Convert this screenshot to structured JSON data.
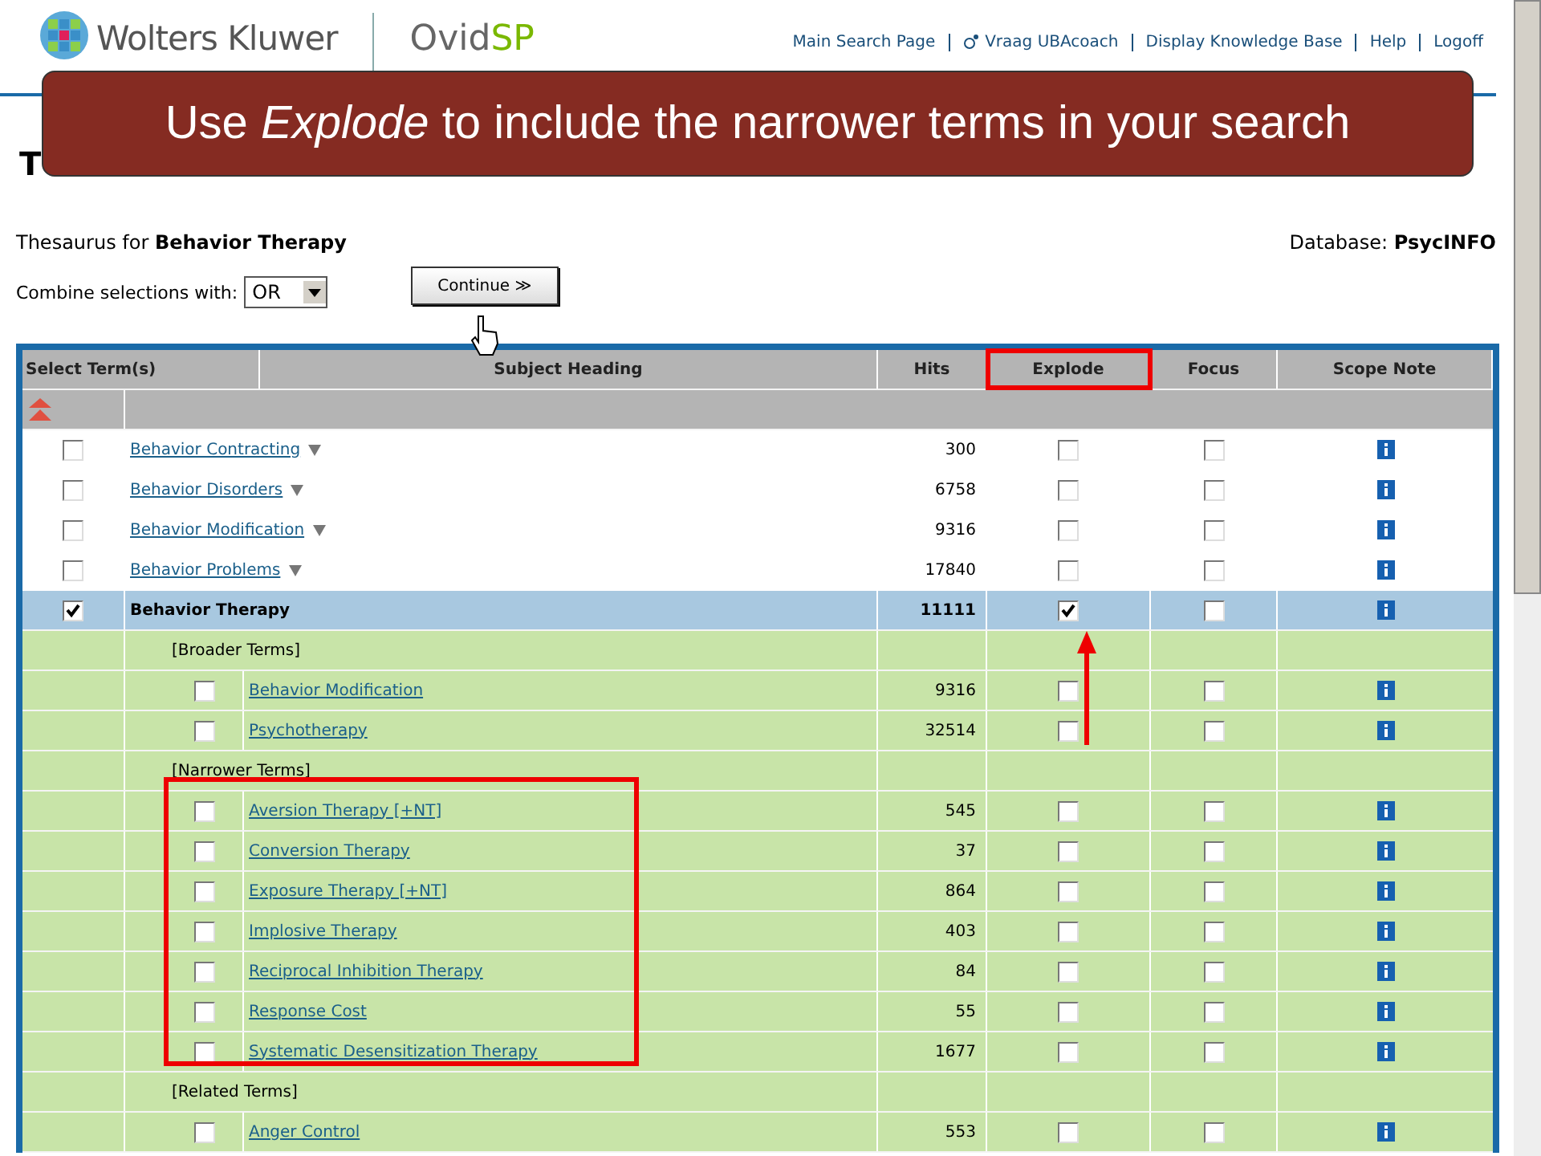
{
  "header": {
    "brand": "Wolters Kluwer",
    "product": "Ovid",
    "product_suffix": "SP",
    "nav": [
      {
        "label": "Main Search Page",
        "kind": "link"
      },
      {
        "label": "Vraag UBAcoach",
        "kind": "coach"
      },
      {
        "label": "Display Knowledge Base",
        "kind": "link"
      },
      {
        "label": "Help",
        "kind": "link"
      },
      {
        "label": "Logoff",
        "kind": "link"
      }
    ]
  },
  "callout": "Use *Explode* to include the narrower terms in your search",
  "page_title": "T",
  "thesaurus": {
    "prefix": "Thesaurus for",
    "term": "Behavior Therapy",
    "db_label": "Database:",
    "db": "PsycINFO"
  },
  "combine": {
    "label": "Combine selections with:",
    "value": "OR",
    "button": "Continue ≫"
  },
  "table": {
    "columns": [
      "Select Term(s)",
      "Subject Heading",
      "Hits",
      "Explode",
      "Focus",
      "Scope Note"
    ],
    "rows": [
      {
        "kind": "term",
        "label": "Behavior Contracting",
        "hits": "300",
        "checked": false,
        "explode": false,
        "focus": false,
        "has_menu": true
      },
      {
        "kind": "term",
        "label": "Behavior Disorders",
        "hits": "6758",
        "checked": false,
        "explode": false,
        "focus": false,
        "has_menu": true
      },
      {
        "kind": "term",
        "label": "Behavior Modification",
        "hits": "9316",
        "checked": false,
        "explode": false,
        "focus": false,
        "has_menu": true
      },
      {
        "kind": "term",
        "label": "Behavior Problems",
        "hits": "17840",
        "checked": false,
        "explode": false,
        "focus": false,
        "has_menu": true
      },
      {
        "kind": "current",
        "label": "Behavior Therapy",
        "hits": "11111",
        "checked": true,
        "explode": true,
        "focus": false
      },
      {
        "kind": "section",
        "label": "[Broader Terms]"
      },
      {
        "kind": "related",
        "label": "Behavior Modification",
        "hits": "9316",
        "checked": false,
        "explode": false,
        "focus": false
      },
      {
        "kind": "related",
        "label": "Psychotherapy",
        "hits": "32514",
        "checked": false,
        "explode": false,
        "focus": false
      },
      {
        "kind": "section",
        "label": "[Narrower Terms]"
      },
      {
        "kind": "related",
        "label": "Aversion Therapy [+NT]",
        "hits": "545",
        "checked": false,
        "explode": false,
        "focus": false
      },
      {
        "kind": "related",
        "label": "Conversion Therapy",
        "hits": "37",
        "checked": false,
        "explode": false,
        "focus": false
      },
      {
        "kind": "related",
        "label": "Exposure Therapy [+NT]",
        "hits": "864",
        "checked": false,
        "explode": false,
        "focus": false
      },
      {
        "kind": "related",
        "label": "Implosive Therapy",
        "hits": "403",
        "checked": false,
        "explode": false,
        "focus": false
      },
      {
        "kind": "related",
        "label": "Reciprocal Inhibition Therapy",
        "hits": "84",
        "checked": false,
        "explode": false,
        "focus": false
      },
      {
        "kind": "related",
        "label": "Response Cost",
        "hits": "55",
        "checked": false,
        "explode": false,
        "focus": false
      },
      {
        "kind": "related",
        "label": "Systematic Desensitization Therapy",
        "hits": "1677",
        "checked": false,
        "explode": false,
        "focus": false
      },
      {
        "kind": "section",
        "label": "[Related Terms]"
      },
      {
        "kind": "related",
        "label": "Anger Control",
        "hits": "553",
        "checked": false,
        "explode": false,
        "focus": false
      }
    ]
  }
}
